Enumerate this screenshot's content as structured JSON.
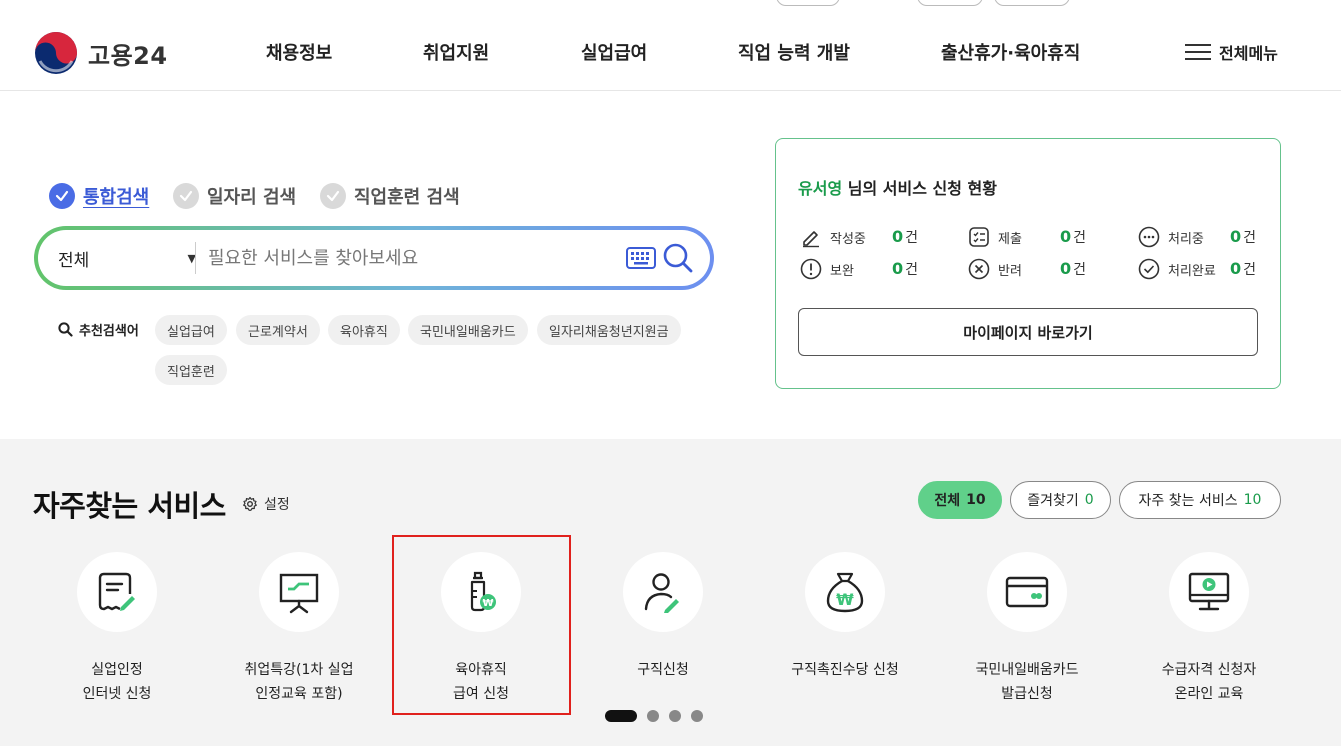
{
  "header": {
    "logo_text": "고용24",
    "nav": [
      "채용정보",
      "취업지원",
      "실업급여",
      "직업 능력 개발",
      "출산휴가·육아휴직"
    ],
    "all_menu_label": "전체메뉴"
  },
  "search": {
    "scopes": [
      {
        "label": "통합검색",
        "active": true
      },
      {
        "label": "일자리 검색",
        "active": false
      },
      {
        "label": "직업훈련 검색",
        "active": false
      }
    ],
    "select_value": "전체",
    "placeholder": "필요한 서비스를 찾아보세요",
    "recommend_title": "추천검색어",
    "recommend_keywords": [
      "실업급여",
      "근로계약서",
      "육아휴직",
      "국민내일배움카드",
      "일자리채움청년지원금",
      "직업훈련"
    ]
  },
  "status_panel": {
    "user_name": "유서영",
    "title_suffix": " 님의 서비스 신청 현황",
    "unit": "건",
    "items": [
      {
        "label": "작성중",
        "count": "0",
        "icon": "pencil-icon"
      },
      {
        "label": "제출",
        "count": "0",
        "icon": "checklist-icon"
      },
      {
        "label": "처리중",
        "count": "0",
        "icon": "ellipsis-icon"
      },
      {
        "label": "보완",
        "count": "0",
        "icon": "exclamation-icon"
      },
      {
        "label": "반려",
        "count": "0",
        "icon": "x-circle-icon"
      },
      {
        "label": "처리완료",
        "count": "0",
        "icon": "check-circle-icon"
      }
    ],
    "mypage_button": "마이페이지 바로가기"
  },
  "favorites": {
    "title": "자주찾는 서비스",
    "setting_label": "설정",
    "tabs": [
      {
        "label": "전체",
        "count": "10",
        "active": true
      },
      {
        "label": "즐겨찾기",
        "count": "0",
        "active": false
      },
      {
        "label": "자주 찾는 서비스",
        "count": "10",
        "active": false
      }
    ],
    "services": [
      {
        "label": "실업인정\n인터넷 신청",
        "icon": "document-pen-icon"
      },
      {
        "label": "취업특강(1차 실업\n인정교육 포함)",
        "icon": "presentation-board-icon"
      },
      {
        "label": "육아휴직\n급여 신청",
        "icon": "baby-bottle-won-icon",
        "highlighted": true
      },
      {
        "label": "구직신청",
        "icon": "person-pen-icon"
      },
      {
        "label": "구직촉진수당 신청",
        "icon": "money-bag-won-icon"
      },
      {
        "label": "국민내일배움카드\n발급신청",
        "icon": "card-icon"
      },
      {
        "label": "수급자격 신청자\n온라인 교육",
        "icon": "monitor-play-icon"
      }
    ],
    "pages": 4,
    "current_page": 1
  },
  "colors": {
    "brand_green": "#1a9b4b",
    "active_tab": "#60d08a",
    "search_active": "#3b5bd6",
    "highlight": "#e0201c"
  }
}
